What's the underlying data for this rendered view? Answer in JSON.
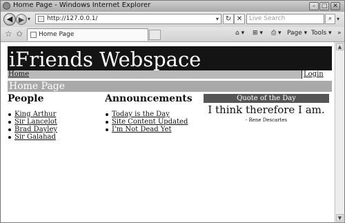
{
  "window": {
    "title": "Home Page - Windows Internet Explorer",
    "minimize": "–",
    "maximize": "□",
    "close": "✕"
  },
  "address_bar": {
    "url": "http://127.0.0.1/",
    "search_placeholder": "Live Search",
    "back_icon": "back-arrow-icon",
    "forward_icon": "forward-arrow-icon"
  },
  "tab_row": {
    "tab_label": "Home Page",
    "commands": {
      "home": "⌂ ▾",
      "feeds": "⊞ ▾",
      "print": "⎙ ▾",
      "page": "Page ▾",
      "tools": "Tools ▾",
      "more": "»"
    }
  },
  "page": {
    "banner_title": "iFriends Webspace",
    "nav": {
      "home": "Home",
      "login": "Login"
    },
    "page_title": "Home Page",
    "people": {
      "heading": "People",
      "items": [
        "King Arthur",
        "Sir Lancelot",
        "Brad Dayley",
        "Sir Galahad"
      ]
    },
    "announcements": {
      "heading": "Announcements",
      "items": [
        "Today is the Day",
        "Site Content Updated",
        "I'm Not Dead Yet"
      ]
    },
    "quote": {
      "heading": "Quote of the Day",
      "text": "I think therefore I am.",
      "author": "- Rene Descartes"
    }
  },
  "colors": {
    "banner_bg": "#141414",
    "nav_bg": "#b9b9b9",
    "pagebar_bg": "#a9a9a9",
    "quote_head_bg": "#555555"
  }
}
